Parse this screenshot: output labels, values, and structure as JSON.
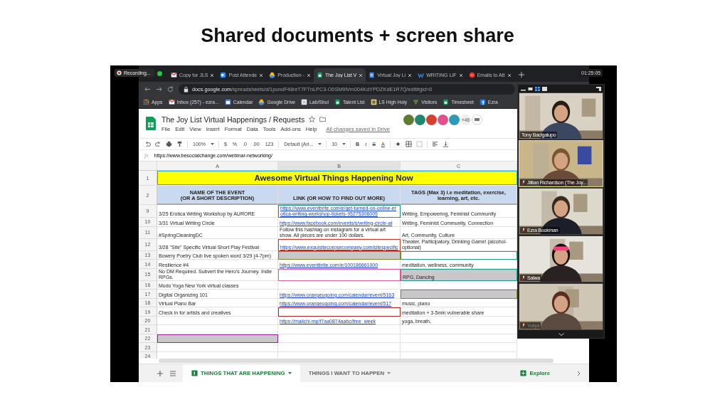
{
  "slide_title": "Shared documents + screen share",
  "recording": "Recording...",
  "clock": "01:25:05",
  "browser": {
    "tabs": [
      {
        "title": "Copy for JLS",
        "selected": false
      },
      {
        "title": "Post Attende",
        "selected": false
      },
      {
        "title": "Production -",
        "selected": false
      },
      {
        "title": "The Joy List V",
        "selected": true
      },
      {
        "title": "Virtual Joy Li",
        "selected": false
      },
      {
        "title": "WRITING LIF",
        "selected": false
      },
      {
        "title": "Emails to Att",
        "selected": false
      }
    ],
    "url": "**docs.google.com**/spreadsheets/d/1pundF48nrT7FTnLPC3-O0SM9lVm004KdYPDZKdE1R7Q/edit#gid=0",
    "bookmarks": [
      "Apps",
      "Inbox (257) - ezra...",
      "Calendar",
      "Google Drive",
      "Lab/Shul",
      "Talent List",
      "LS High Holy",
      "Visitors",
      "Timesheet",
      "Ezra"
    ]
  },
  "sheet": {
    "title": "The Joy List Virtual Happenings / Requests",
    "menus": [
      "File",
      "Edit",
      "View",
      "Insert",
      "Format",
      "Data",
      "Tools",
      "Add-ons",
      "Help"
    ],
    "saved_status": "All changes saved in Drive",
    "avatars": [
      {
        "color": "#5f7d2e"
      },
      {
        "color": "#1f8a70"
      },
      {
        "color": "#d6402f"
      },
      {
        "color": "#e0508a"
      },
      {
        "color": "#2a9bb8"
      }
    ],
    "more_viewers": "+46",
    "toolbar": {
      "zoom": "100%",
      "number_formats": [
        "$",
        "%",
        ".0",
        ".00",
        "123"
      ],
      "font": "Default (Ari...",
      "font_size": "10",
      "styles": [
        "B",
        "I",
        "S",
        "A"
      ]
    },
    "formula_label": "fx",
    "formula": "https://www.besocialchange.com/webinar-networking/",
    "columns": [
      "A",
      "B",
      "C"
    ],
    "banner": {
      "row": "1",
      "text": "Awesome Virtual Things Happening Now"
    },
    "header": {
      "row": "2",
      "cells": [
        "NAME OF THE EVENT\n(OR A SHORT DESCRIPTION)",
        "LINK (OR HOW TO FIND OUT MORE)",
        "TAGS (Max 3) i.e meditation, exercise, learning, art, etc."
      ]
    },
    "rows": [
      {
        "number": "9",
        "cells": [
          {
            "kind": "text",
            "text": "3/25 Erotica Writing Workshop by AURORE",
            "shaded": false
          },
          {
            "kind": "link",
            "text": "https://www.eventbrite.com/e/get-turned-on-online-erotica-writing-workshop-tickets-95275306005",
            "shaded": false,
            "color": "#1e8e7e"
          },
          {
            "kind": "text",
            "text": "Writing, Empowering, Feminist Community",
            "shaded": false
          }
        ]
      },
      {
        "number": "10",
        "cells": [
          {
            "kind": "text",
            "text": "3/31 Virtual Writing Circle",
            "shaded": false
          },
          {
            "kind": "link",
            "text": "https://www.facebook.com/events/s/writing-circle-at",
            "shaded": false
          },
          {
            "kind": "text",
            "text": "Writing, Feminist Community, Connection",
            "shaded": false
          }
        ]
      },
      {
        "number": "11",
        "cells": [
          {
            "kind": "text",
            "text": "#SpringCleaningDC",
            "shaded": false
          },
          {
            "kind": "text",
            "text": "Follow this hashtag on instagram for a virtual art show. All pieces are under 100 dollars.",
            "shaded": false
          },
          {
            "kind": "text",
            "text": "Art, Community, Culture",
            "shaded": false
          }
        ]
      },
      {
        "number": "12",
        "cells": [
          {
            "kind": "text",
            "text": "3/28 \"Site\" Specific Virtual Short Play Festival",
            "shaded": false
          },
          {
            "kind": "link",
            "text": "https://www.exquisitecorpsecompany.com/sitespecific",
            "shaded": false,
            "color": "#d03a2c"
          },
          {
            "kind": "text",
            "text": "Theater, Participatory, Drinking Game! (alcohol-optional)",
            "shaded": false
          }
        ]
      },
      {
        "number": "13",
        "cells": [
          {
            "kind": "text",
            "text": "Bowery Poetry Club live spoken word 3/29 (4-7pm)",
            "shaded": false
          },
          {
            "kind": "blank",
            "shaded": true,
            "color": "#7c8a2a"
          },
          {
            "kind": "blank",
            "shaded": false,
            "color": "#1e9e8a"
          }
        ]
      },
      {
        "number": "14",
        "cells": [
          {
            "kind": "text",
            "text": "Resilience #4",
            "shaded": false
          },
          {
            "kind": "link",
            "text": "https://www.eventbrite.com/e/100186661000",
            "shaded": false
          },
          {
            "kind": "text",
            "text": "meditation, wellness, community",
            "shaded": false
          }
        ]
      },
      {
        "number": "15",
        "cells": [
          {
            "kind": "text",
            "text": "No DM Required. Subvert the Hero's Journey. Indie RPGs.",
            "shaded": false
          },
          {
            "kind": "blank",
            "shaded": false,
            "color": "#e0609a"
          },
          {
            "kind": "text",
            "text": "RPG, Dancing",
            "shaded": true,
            "color": "#1e9e8a"
          }
        ]
      },
      {
        "number": "16",
        "cells": [
          {
            "kind": "text",
            "text": "Modo Yoga New York virtual classes",
            "shaded": false
          },
          {
            "kind": "blank",
            "shaded": false
          },
          {
            "kind": "blank",
            "shaded": false
          }
        ]
      },
      {
        "number": "17",
        "cells": [
          {
            "kind": "text",
            "text": "Digital Organizing 101",
            "shaded": false
          },
          {
            "kind": "link",
            "text": "https://www.orangeugoing.com/calendar/event/5163",
            "shaded": false
          },
          {
            "kind": "blank",
            "shaded": true,
            "color": "#7c8a2a"
          }
        ]
      },
      {
        "number": "18",
        "cells": [
          {
            "kind": "text",
            "text": "Virtual Piano Bar",
            "shaded": false
          },
          {
            "kind": "link",
            "text": "https://www.orangeugoing.com/calendar/event/517",
            "shaded": false
          },
          {
            "kind": "text",
            "text": "music, piano",
            "shaded": false
          }
        ]
      },
      {
        "number": "19",
        "cells": [
          {
            "kind": "text",
            "text": "Check in for artists and creatives",
            "shaded": false
          },
          {
            "kind": "blank",
            "shaded": false,
            "color": "#b3261e"
          },
          {
            "kind": "text",
            "text": "meditation + 3-5min vulnerable share",
            "shaded": false
          }
        ]
      },
      {
        "number": "20",
        "cells": [
          {
            "kind": "blank",
            "shaded": false
          },
          {
            "kind": "link",
            "text": "https://mailchi.mp/f7aa0874aabc/free_week",
            "shaded": false
          },
          {
            "kind": "text",
            "text": "yoga, breath,",
            "shaded": false
          }
        ]
      },
      {
        "number": "21",
        "cells": [
          {
            "kind": "blank",
            "shaded": false
          },
          {
            "kind": "blank",
            "shaded": false
          },
          {
            "kind": "blank",
            "shaded": false
          }
        ]
      },
      {
        "number": "22",
        "cells": [
          {
            "kind": "blank",
            "shaded": true,
            "color": "#a020a0"
          },
          {
            "kind": "blank",
            "shaded": false
          },
          {
            "kind": "blank",
            "shaded": false
          }
        ]
      },
      {
        "number": "23",
        "cells": [
          {
            "kind": "blank",
            "shaded": false
          },
          {
            "kind": "blank",
            "shaded": false
          },
          {
            "kind": "blank",
            "shaded": false
          }
        ]
      },
      {
        "number": "24",
        "cells": [
          {
            "kind": "blank",
            "shaded": false
          },
          {
            "kind": "blank",
            "shaded": false
          },
          {
            "kind": "blank",
            "shaded": false
          }
        ]
      }
    ],
    "sheet_tabs": [
      {
        "label": "THINGS THAT ARE HAPPENING",
        "selected": true
      },
      {
        "label": "THINGS I WANT TO HAPPEN",
        "selected": false
      }
    ],
    "explore": "Explore"
  },
  "meeting": {
    "participants": [
      {
        "name": "Tony Bacigalupo",
        "muted": false,
        "active": false
      },
      {
        "name": "Jillian Richardson (The Joy...",
        "muted": true,
        "active": true
      },
      {
        "name": "Ezra Bookman",
        "muted": true,
        "active": false
      },
      {
        "name": "Salwa",
        "muted": true,
        "active": false
      },
      {
        "name": "Yuliya",
        "muted": true,
        "active": false
      }
    ]
  }
}
